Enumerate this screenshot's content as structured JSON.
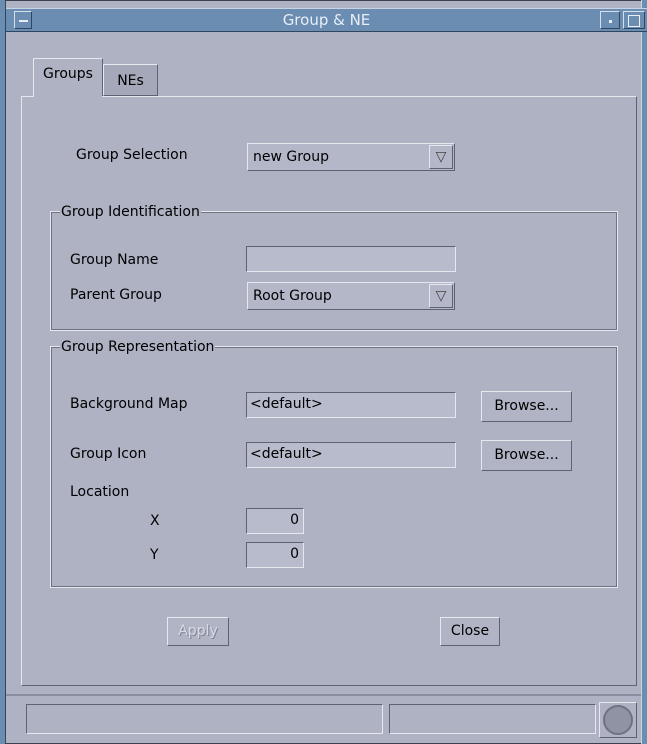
{
  "window": {
    "title": "Group & NE",
    "colors": {
      "titlebar": "#6b8db2",
      "background": "#aeb2c3"
    }
  },
  "tabs": [
    {
      "label": "Groups",
      "active": true
    },
    {
      "label": "NEs",
      "active": false
    }
  ],
  "selection": {
    "label": "Group Selection",
    "value": "new Group"
  },
  "identification": {
    "legend": "Group Identification",
    "name_label": "Group Name",
    "name_value": "",
    "parent_label": "Parent Group",
    "parent_value": "Root Group"
  },
  "representation": {
    "legend": "Group Representation",
    "bg_map_label": "Background Map",
    "bg_map_value": "<default>",
    "icon_label": "Group Icon",
    "icon_value": "<default>",
    "browse_label": "Browse...",
    "location_label": "Location",
    "x_label": "X",
    "x_value": "0",
    "y_label": "Y",
    "y_value": "0"
  },
  "actions": {
    "apply_label": "Apply",
    "close_label": "Close"
  },
  "status_bar": {
    "left_text": "",
    "right_text": "",
    "icon": "stop-icon"
  }
}
